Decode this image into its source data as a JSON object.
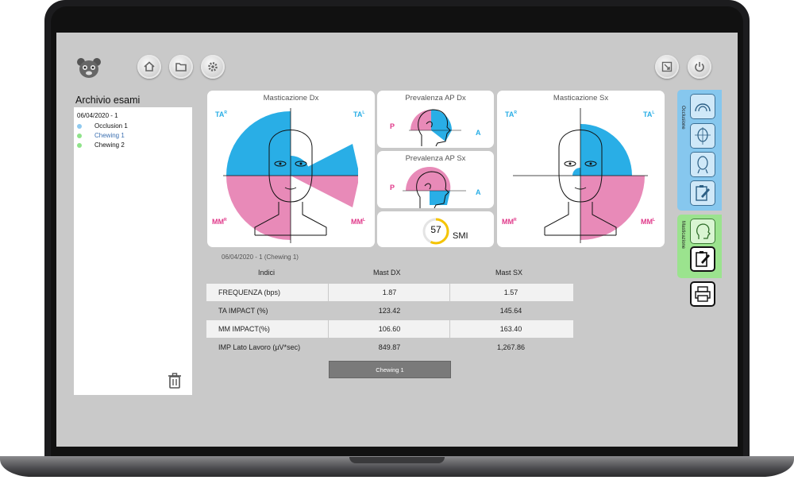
{
  "toolbar": {
    "logo_icon": "mascot-logo-icon",
    "buttons": [
      "home-icon",
      "folder-icon",
      "gear-icon"
    ],
    "right_buttons": [
      "export-icon",
      "power-icon"
    ]
  },
  "archive": {
    "title": "Archivio esami",
    "date": "06/04/2020 - 1",
    "items": [
      {
        "label": "Occlusion 1",
        "color": "#8fc9ef"
      },
      {
        "label": "Chewing 1",
        "color": "#8fe38a"
      },
      {
        "label": "Chewing 2",
        "color": "#8fe38a"
      }
    ],
    "trash_icon": "trash-icon"
  },
  "cards": {
    "left": {
      "title": "Masticazione Dx",
      "ta_r": "TA",
      "ta_r_sup": "R",
      "ta_l": "TA",
      "ta_l_sup": "L",
      "mm_r": "MM",
      "mm_r_sup": "R",
      "mm_l": "MM",
      "mm_l_sup": "L"
    },
    "right": {
      "title": "Masticazione Sx",
      "ta_r": "TA",
      "ta_r_sup": "R",
      "ta_l": "TA",
      "ta_l_sup": "L",
      "mm_r": "MM",
      "mm_r_sup": "R",
      "mm_l": "MM",
      "mm_l_sup": "L"
    },
    "ap_dx": {
      "title": "Prevalenza AP Dx",
      "p": "P",
      "a": "A"
    },
    "ap_sx": {
      "title": "Prevalenza AP Sx",
      "p": "P",
      "a": "A"
    },
    "smi": {
      "value": "57",
      "label": "SMI",
      "level": 0.57
    }
  },
  "caption": "06/04/2020 - 1  (Chewing 1)",
  "table": {
    "headers": [
      "Indici",
      "Mast DX",
      "Mast SX"
    ],
    "rows": [
      [
        "FREQUENZA (bps)",
        "1.87",
        "1.57"
      ],
      [
        "TA IMPACT (%)",
        "123.42",
        "145.64"
      ],
      [
        "MM IMPACT(%)",
        "106.60",
        "163.40"
      ],
      [
        "IMP Lato Lavoro (µV*sec)",
        "849.87",
        "1,267.86"
      ]
    ]
  },
  "chewing_button": "Chewing 1",
  "side_tabs": {
    "occlusion_label": "Occlusione",
    "mastication_label": "Masticazione",
    "colors": {
      "occlusion": "#86c7ee",
      "mastication": "#9be38e"
    }
  },
  "colors": {
    "cyan": "#29aee6",
    "pink": "#e88ab8"
  }
}
